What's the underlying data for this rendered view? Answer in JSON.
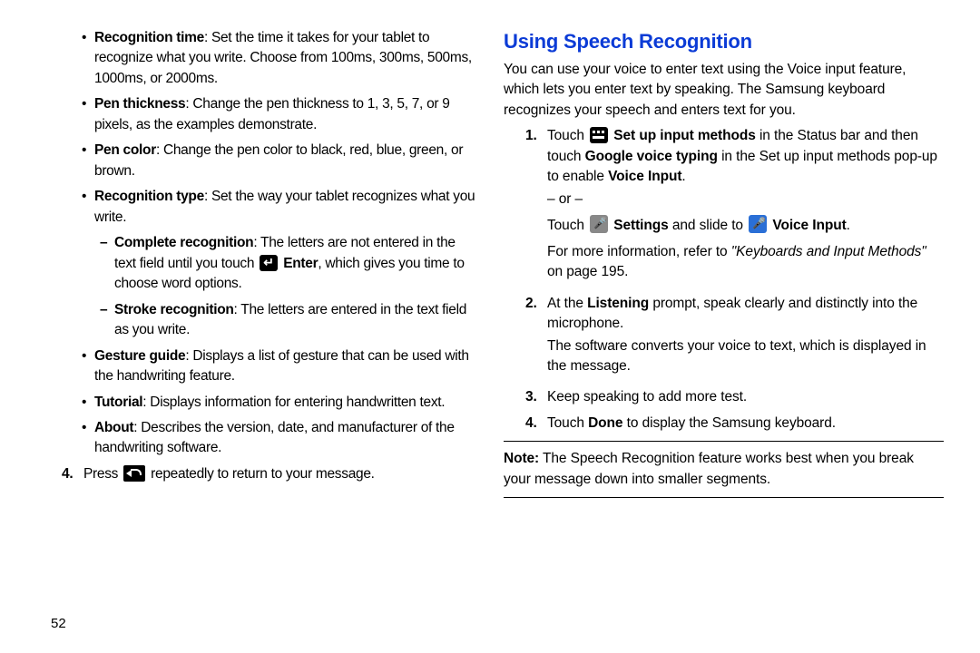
{
  "left": {
    "b1": {
      "bold": "Recognition time",
      "text": ": Set the time it takes for your tablet to recognize what you write. Choose from 100ms, 300ms, 500ms, 1000ms, or 2000ms."
    },
    "b2": {
      "bold": "Pen thickness",
      "text": ": Change the pen thickness to 1, 3, 5, 7, or 9 pixels, as the examples demonstrate."
    },
    "b3": {
      "bold": "Pen color",
      "text": ": Change the pen color to black, red, blue, green, or brown."
    },
    "b4": {
      "bold": "Recognition type",
      "text": ": Set the way your tablet recognizes what you write."
    },
    "s1a": {
      "bold": "Complete recognition",
      "text1": ": The letters are not entered in the text field until you touch ",
      "bold2": "Enter",
      "text2": ", which gives you time to choose word options."
    },
    "s1b": {
      "bold": "Stroke recognition",
      "text": ": The letters are entered in the text field as you write."
    },
    "b5": {
      "bold": "Gesture guide",
      "text": ": Displays a list of gesture that can be used with the handwriting feature."
    },
    "b6": {
      "bold": "Tutorial",
      "text": ": Displays information for entering handwritten text."
    },
    "b7": {
      "bold": "About",
      "text": ": Describes the version, date, and manufacturer of the handwriting software."
    },
    "n4": {
      "mark": "4.",
      "text1": "Press ",
      "text2": " repeatedly to return to your message."
    }
  },
  "right": {
    "heading": "Using Speech Recognition",
    "intro": "You can use your voice to enter text using the Voice input feature, which lets you enter text by speaking. The Samsung keyboard recognizes your speech and enters text for you.",
    "n1": {
      "mark": "1.",
      "t1": "Touch ",
      "b1": "Set up input methods",
      "t2": " in the Status bar and then touch ",
      "b2": "Google voice typing",
      "t3": " in the Set up input methods pop-up to enable ",
      "b3": "Voice Input",
      "t4": ".",
      "or": "– or –",
      "t5": "Touch ",
      "b4": "Settings",
      "t6": " and slide to ",
      "b5": "Voice Input",
      "t7": ".",
      "ref1": "For more information, refer to ",
      "refi": "\"Keyboards and Input Methods\"",
      "ref2": "  on page 195."
    },
    "n2": {
      "mark": "2.",
      "t1": "At the ",
      "b1": "Listening",
      "t2": " prompt, speak clearly and distinctly into the microphone.",
      "t3": "The software converts your voice to text, which is displayed in the message."
    },
    "n3": {
      "mark": "3.",
      "t": "Keep speaking to add more test."
    },
    "n4": {
      "mark": "4.",
      "t1": "Touch ",
      "b1": "Done",
      "t2": " to display the Samsung keyboard."
    },
    "note": {
      "label": "Note:",
      "text": " The Speech Recognition feature works best when you break your message down into smaller segments."
    }
  },
  "page_number": "52"
}
